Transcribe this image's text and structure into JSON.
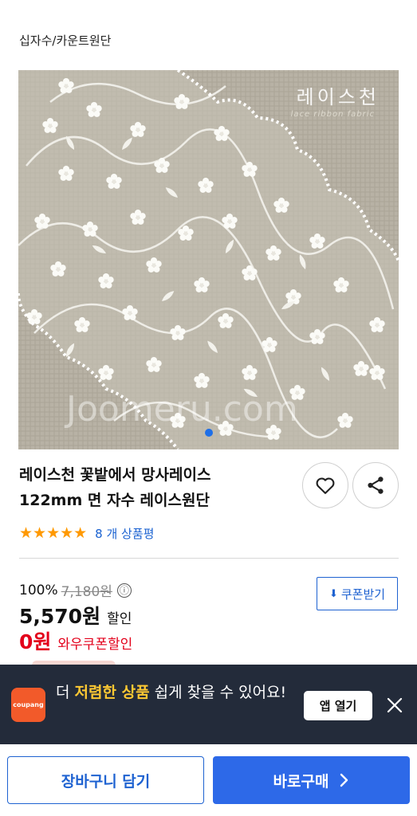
{
  "breadcrumb": "십자수/카운트원단",
  "image": {
    "brand_text": "레이스천",
    "brand_sub": "lace ribbon fabric",
    "watermark": "Joomeru.com",
    "carousel_active_index": 0
  },
  "product": {
    "title_line1": "레이스천 꽃밭에서 망사레이스",
    "title_line2": "122mm 면 자수 레이스원단",
    "rating": 4.5,
    "stars": "★★★★★",
    "review_count": "8 개 상품평"
  },
  "price": {
    "discount_rate": "100%",
    "original_price": "7,180원",
    "info_icon": "ⓘ",
    "sale_price": "5,570원",
    "sale_label": "할인",
    "coupon_price": "0원",
    "coupon_label": "와우쿠폰할인",
    "coupon_button": "쿠폰받기"
  },
  "app_banner": {
    "logo_text": "coupang",
    "text_prefix": "더 ",
    "text_highlight": "저렴한 상품",
    "text_suffix": " 쉽게 찾을 수 있어요!",
    "open_button": "앱 열기"
  },
  "bottom_bar": {
    "cart_button": "장바구니 담기",
    "buy_button": "바로구매"
  },
  "colors": {
    "accent_blue": "#2d69e8",
    "link_blue": "#1a62d1",
    "coupon_red": "#e3001b",
    "star_orange": "#ff9900",
    "banner_bg": "#232b3a",
    "banner_highlight": "#ffc933"
  },
  "icons": {
    "heart": "heart-icon",
    "share": "share-icon",
    "download": "download-icon",
    "close": "close-icon",
    "chevron": "chevron-right-icon",
    "info": "info-icon"
  }
}
